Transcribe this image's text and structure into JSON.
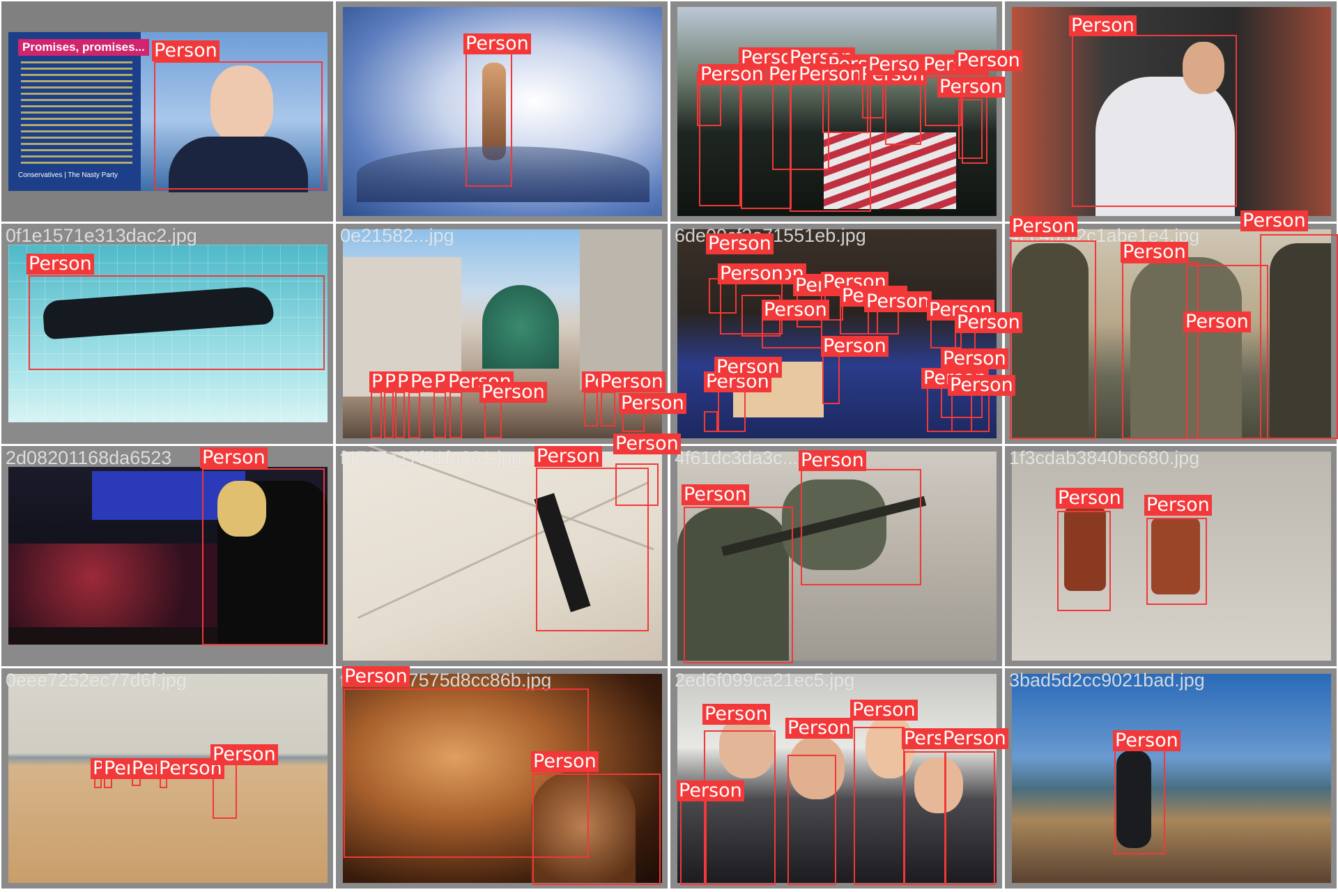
{
  "label_color": "#f23838",
  "class_name": "Person",
  "tiles": [
    {
      "filename": "",
      "scene": "campaign-poster",
      "poster": {
        "title": "Promises, promises...",
        "party": "Conservatives | The Nasty Party"
      }
    },
    {
      "filename": "",
      "scene": "sky-figure"
    },
    {
      "filename": "",
      "scene": "military-funeral"
    },
    {
      "filename": "",
      "scene": "race-car-driver"
    },
    {
      "filename": "0f1e1571e313dac2.jpg",
      "scene": "underwater-diver"
    },
    {
      "filename": "0e21582...jpg",
      "scene": "japanese-street"
    },
    {
      "filename": "6de09cf2e71551eb.jpg",
      "scene": "church-interior"
    },
    {
      "filename": "4ec405f2c1abe1e4.jpg",
      "scene": "soldiers"
    },
    {
      "filename": "2d08201168da6523",
      "scene": "stage-keyboard"
    },
    {
      "filename": "f4707a27f51fa381.jpg",
      "scene": "trapeze"
    },
    {
      "filename": "4f61dc3da3c...jpg",
      "scene": "snipers"
    },
    {
      "filename": "1f3cdab3840bc680.jpg",
      "scene": "lego-figures"
    },
    {
      "filename": "0eee7252ec77d6f.jpg",
      "scene": "beach"
    },
    {
      "filename": "f1667167575d8cc86b.jpg",
      "scene": "statue"
    },
    {
      "filename": "2ed6f099ca21ec5.jpg",
      "scene": "group-selfie"
    },
    {
      "filename": "3bad5d2cc9021bad.jpg",
      "scene": "cyclist-hill"
    }
  ]
}
